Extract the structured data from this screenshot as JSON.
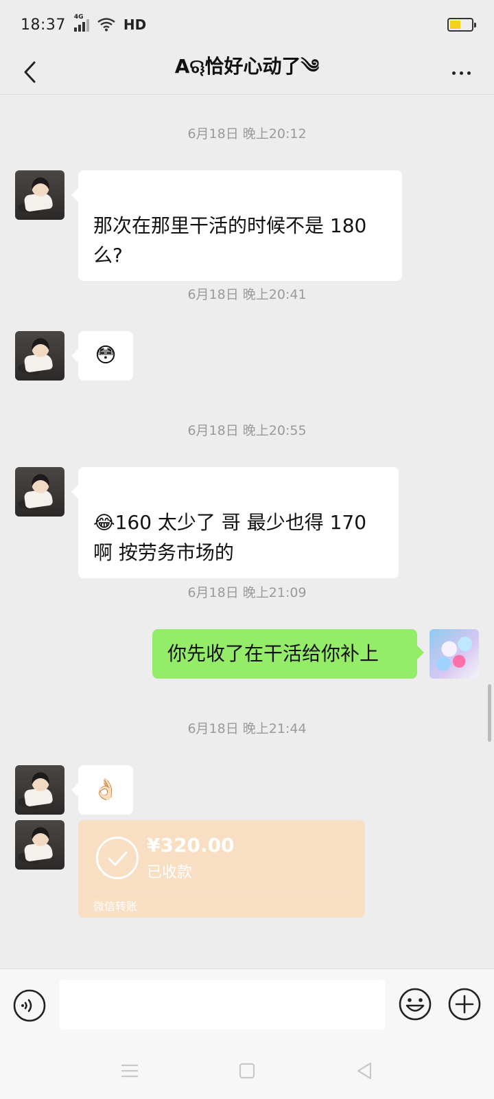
{
  "status_bar": {
    "time": "18:37",
    "network": "4G",
    "hd": "HD",
    "battery_level": 0.5,
    "battery_color": "#f4d21a"
  },
  "nav": {
    "title": "Aୠ恰好心动了༄"
  },
  "messages": [
    {
      "timestamp": "6月18日 晚上20:12",
      "sender": "other",
      "text": "那次在那里干活的时候不是 180\n么?"
    },
    {
      "timestamp": "6月18日 晚上20:41",
      "sender": "other",
      "emoji": "😳"
    },
    {
      "timestamp": "6月18日 晚上20:55",
      "sender": "other",
      "emoji": "😂",
      "text": "160 太少了 哥  最少也得 170\n啊  按劳务市场的"
    },
    {
      "timestamp": "6月18日 晚上21:09",
      "sender": "me",
      "text": "你先收了在干活给你补上"
    },
    {
      "timestamp": "6月18日 晚上21:44",
      "sender": "other",
      "emoji": "👌🏻"
    }
  ],
  "transfer": {
    "amount": "¥320.00",
    "status": "已收款",
    "source": "微信转账",
    "color": "#f8dfc3"
  },
  "colors": {
    "background": "#ededed",
    "my_bubble": "#95ec69",
    "their_bubble": "#ffffff",
    "timestamp": "#9a9a9a"
  }
}
